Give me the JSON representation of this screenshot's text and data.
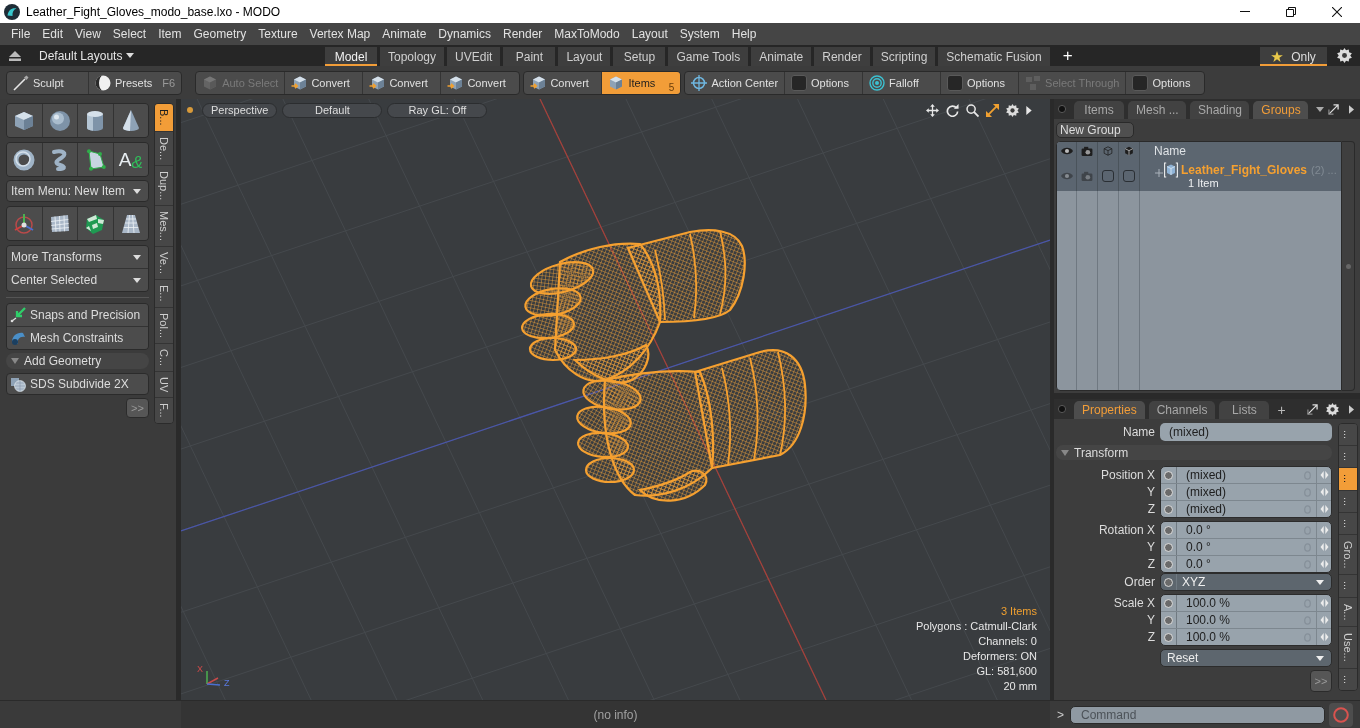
{
  "window": {
    "title": "Leather_Fight_Gloves_modo_base.lxo - MODO"
  },
  "menu_bar": [
    "File",
    "Edit",
    "View",
    "Select",
    "Item",
    "Geometry",
    "Texture",
    "Vertex Map",
    "Animate",
    "Dynamics",
    "Render",
    "MaxToModo",
    "Layout",
    "System",
    "Help"
  ],
  "layout_bar": {
    "layouts_menu": "Default Layouts",
    "tabs": [
      {
        "label": "Model",
        "selected": true
      },
      {
        "label": "Topology",
        "selected": false
      },
      {
        "label": "UVEdit",
        "selected": false
      },
      {
        "label": "Paint",
        "selected": false
      },
      {
        "label": "Layout",
        "selected": false
      },
      {
        "label": "Setup",
        "selected": false
      },
      {
        "label": "Game Tools",
        "selected": false
      },
      {
        "label": "Animate",
        "selected": false
      },
      {
        "label": "Render",
        "selected": false
      },
      {
        "label": "Scripting",
        "selected": false
      },
      {
        "label": "Schematic Fusion",
        "selected": false
      }
    ],
    "add_tab": "+",
    "filter": {
      "label": "Only",
      "on": true
    }
  },
  "toolbar": {
    "mode_buttons": [
      {
        "label": "Sculpt"
      },
      {
        "label": "Presets",
        "shortcut": "F6"
      }
    ],
    "groups": [
      [
        {
          "label": "Auto Select",
          "disabled": true,
          "selected": false
        },
        {
          "label": "Convert",
          "disabled": false,
          "selected": false
        },
        {
          "label": "Convert",
          "disabled": false,
          "selected": false
        },
        {
          "label": "Convert",
          "disabled": false,
          "selected": false
        }
      ],
      [
        {
          "label": "Convert",
          "disabled": false,
          "selected": false
        },
        {
          "label": "Items",
          "disabled": false,
          "selected": true,
          "shortcut": "5"
        }
      ],
      [
        {
          "label": "Action Center",
          "disabled": false,
          "selected": false
        },
        {
          "label": "Options",
          "disabled": false,
          "selected": false
        },
        {
          "label": "Falloff",
          "disabled": false,
          "selected": false
        },
        {
          "label": "Options",
          "disabled": false,
          "selected": false
        },
        {
          "label": "Select Through",
          "disabled": true,
          "selected": false
        },
        {
          "label": "Options",
          "disabled": false,
          "selected": false
        }
      ]
    ]
  },
  "left_panel": {
    "text_tool": {
      "glyph": "A",
      "accent": "&"
    },
    "item_menu": "Item Menu: New Item",
    "transform_menus": [
      "More Transforms",
      "Center Selected"
    ],
    "tool_buttons": [
      "Snaps and Precision",
      "Mesh Constraints"
    ],
    "section": {
      "label": "Add Geometry",
      "expanded": true,
      "buttons": [
        "SDS Subdivide 2X"
      ]
    },
    "more_button": ">>",
    "side_tabs": [
      {
        "label": "B...",
        "selected": true
      },
      {
        "label": "De...",
        "selected": false
      },
      {
        "label": "Dup...",
        "selected": false
      },
      {
        "label": "Mes...",
        "selected": false
      },
      {
        "label": "Ve...",
        "selected": false
      },
      {
        "label": "E...",
        "selected": false
      },
      {
        "label": "Pol...",
        "selected": false
      },
      {
        "label": "C...",
        "selected": false
      },
      {
        "label": "UV",
        "selected": false
      },
      {
        "label": "F...",
        "selected": false
      }
    ]
  },
  "viewport": {
    "view_buttons": [
      "Perspective",
      "Default",
      "Ray GL: Off"
    ],
    "gizmo_labels": [
      "X",
      "Z"
    ],
    "stats": [
      {
        "text": "3 Items",
        "highlighted": true
      },
      {
        "text": "Polygons : Catmull-Clark",
        "highlighted": false
      },
      {
        "text": "Channels: 0",
        "highlighted": false
      },
      {
        "text": "Deformers: ON",
        "highlighted": false
      },
      {
        "text": "GL: 581,600",
        "highlighted": false
      },
      {
        "text": "20 mm",
        "highlighted": false
      }
    ]
  },
  "groups_panel": {
    "tabs": [
      {
        "label": "Items",
        "selected": false
      },
      {
        "label": "Mesh ...",
        "selected": false
      },
      {
        "label": "Shading",
        "selected": false
      },
      {
        "label": "Groups",
        "selected": true
      }
    ],
    "new_group_button": "New Group",
    "name_column": "Name",
    "rows": [
      {
        "name": "Leather_Fight_Gloves",
        "count": "(2) ...",
        "subtitle": "1 Item",
        "expanded": false,
        "toggles": [
          {
            "checked": false
          },
          {
            "checked": false
          }
        ]
      }
    ]
  },
  "properties_panel": {
    "tabs": [
      {
        "label": "Properties",
        "selected": true
      },
      {
        "label": "Channels",
        "selected": false
      },
      {
        "label": "Lists",
        "selected": false
      }
    ],
    "add_tab": "+",
    "name_field": {
      "label": "Name",
      "value": "(mixed)"
    },
    "section": {
      "label": "Transform",
      "expanded": true
    },
    "blocks": [
      {
        "kind": "values",
        "rows": [
          {
            "label": "Position X",
            "value": "(mixed)"
          },
          {
            "label": "Y",
            "value": "(mixed)"
          },
          {
            "label": "Z",
            "value": "(mixed)"
          }
        ]
      },
      {
        "kind": "values",
        "rows": [
          {
            "label": "Rotation X",
            "value": "0.0 °"
          },
          {
            "label": "Y",
            "value": "0.0 °"
          },
          {
            "label": "Z",
            "value": "0.0 °"
          }
        ]
      },
      {
        "kind": "dropdown",
        "rows": [
          {
            "label": "Order",
            "value": "XYZ"
          }
        ]
      },
      {
        "kind": "values",
        "rows": [
          {
            "label": "Scale X",
            "value": "100.0 %"
          },
          {
            "label": "Y",
            "value": "100.0 %"
          },
          {
            "label": "Z",
            "value": "100.0 %"
          }
        ]
      }
    ],
    "reset_menu": "Reset",
    "more_button": ">>",
    "side_tabs": [
      {
        "label": "...",
        "selected": false
      },
      {
        "label": "...",
        "selected": false
      },
      {
        "label": "...",
        "selected": true
      },
      {
        "label": "...",
        "selected": false
      },
      {
        "label": "...",
        "selected": false
      },
      {
        "label": "Gro...",
        "selected": false
      },
      {
        "label": "...",
        "selected": false
      },
      {
        "label": "A...",
        "selected": false
      },
      {
        "label": "Use...",
        "selected": false
      },
      {
        "label": "...",
        "selected": false
      }
    ]
  },
  "status_bar": {
    "info": "(no info)",
    "prompt": ">",
    "command": {
      "placeholder": "Command"
    }
  }
}
